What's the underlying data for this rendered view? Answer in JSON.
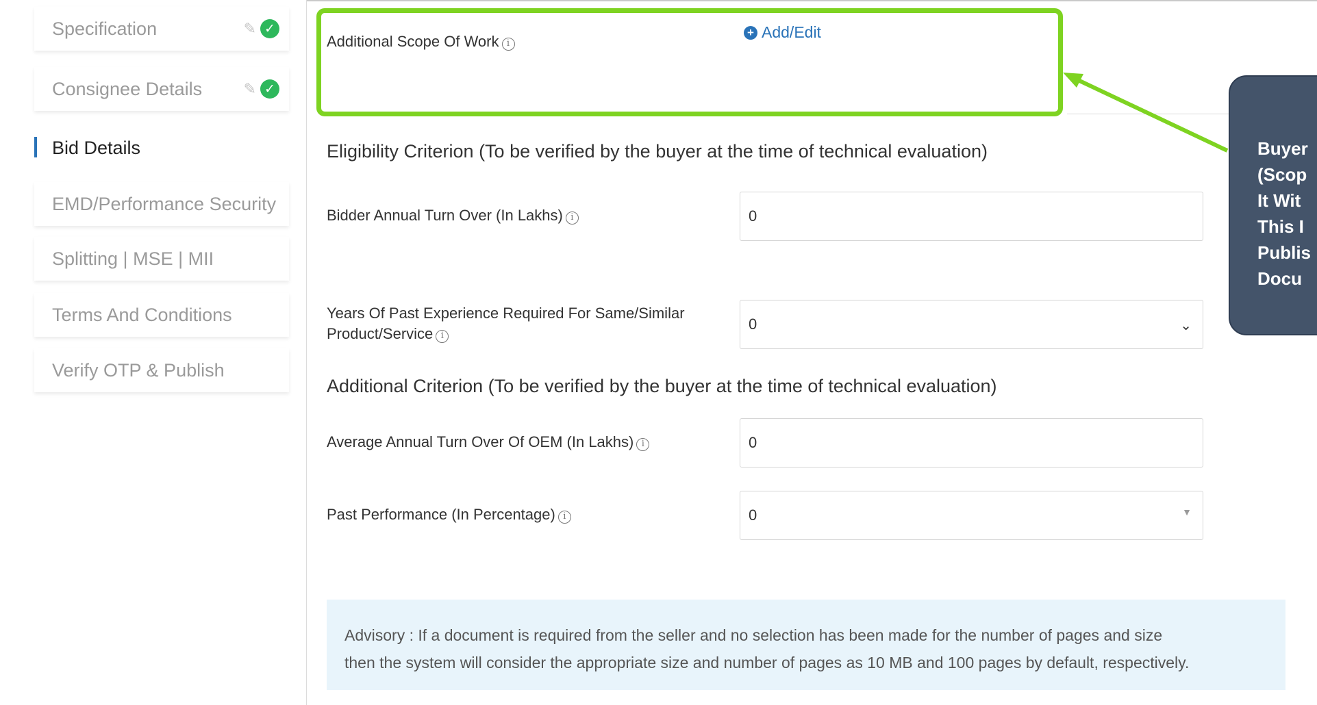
{
  "sidebar": {
    "items": [
      {
        "label": "Specification",
        "done": true
      },
      {
        "label": "Consignee Details",
        "done": true
      },
      {
        "label": "Bid Details",
        "active": true
      },
      {
        "label": "EMD/Performance Security"
      },
      {
        "label": "Splitting | MSE | MII"
      },
      {
        "label": "Terms And Conditions"
      },
      {
        "label": "Verify OTP & Publish"
      }
    ],
    "edit_icon": "pencil-icon",
    "done_icon": "check-circle-icon"
  },
  "scope": {
    "label": "Additional Scope Of Work",
    "add_edit": "Add/Edit"
  },
  "eligibility": {
    "title": "Eligibility Criterion (To be verified by the buyer at the time of technical evaluation)",
    "turnover_label": "Bidder Annual Turn Over (In Lakhs)",
    "turnover_value": "0",
    "experience_label_line1": "Years Of Past Experience Required For Same/Similar",
    "experience_label_line2": "Product/Service",
    "experience_value": "0"
  },
  "additional": {
    "title": "Additional Criterion (To be verified by the buyer at the time of technical evaluation)",
    "oem_label": "Average Annual Turn Over Of OEM (In Lakhs)",
    "oem_value": "0",
    "past_perf_label": "Past Performance (In Percentage)",
    "past_perf_value": "0"
  },
  "advisory": {
    "line1": "Advisory : If a document is required from the seller and no selection has been made for the number of pages and size",
    "line2": "then the system will consider the appropriate size and number of pages as 10 MB and 100 pages by default, respectively."
  },
  "callout": {
    "lines": [
      "Buyer",
      "(Scop",
      "It Wit",
      "This I",
      "Publis",
      "Docu"
    ]
  },
  "colors": {
    "highlight": "#7ed321",
    "link": "#2a73b8",
    "success": "#2eb85c",
    "callout_bg": "#44546a",
    "advisory_bg": "#e8f4fb"
  }
}
